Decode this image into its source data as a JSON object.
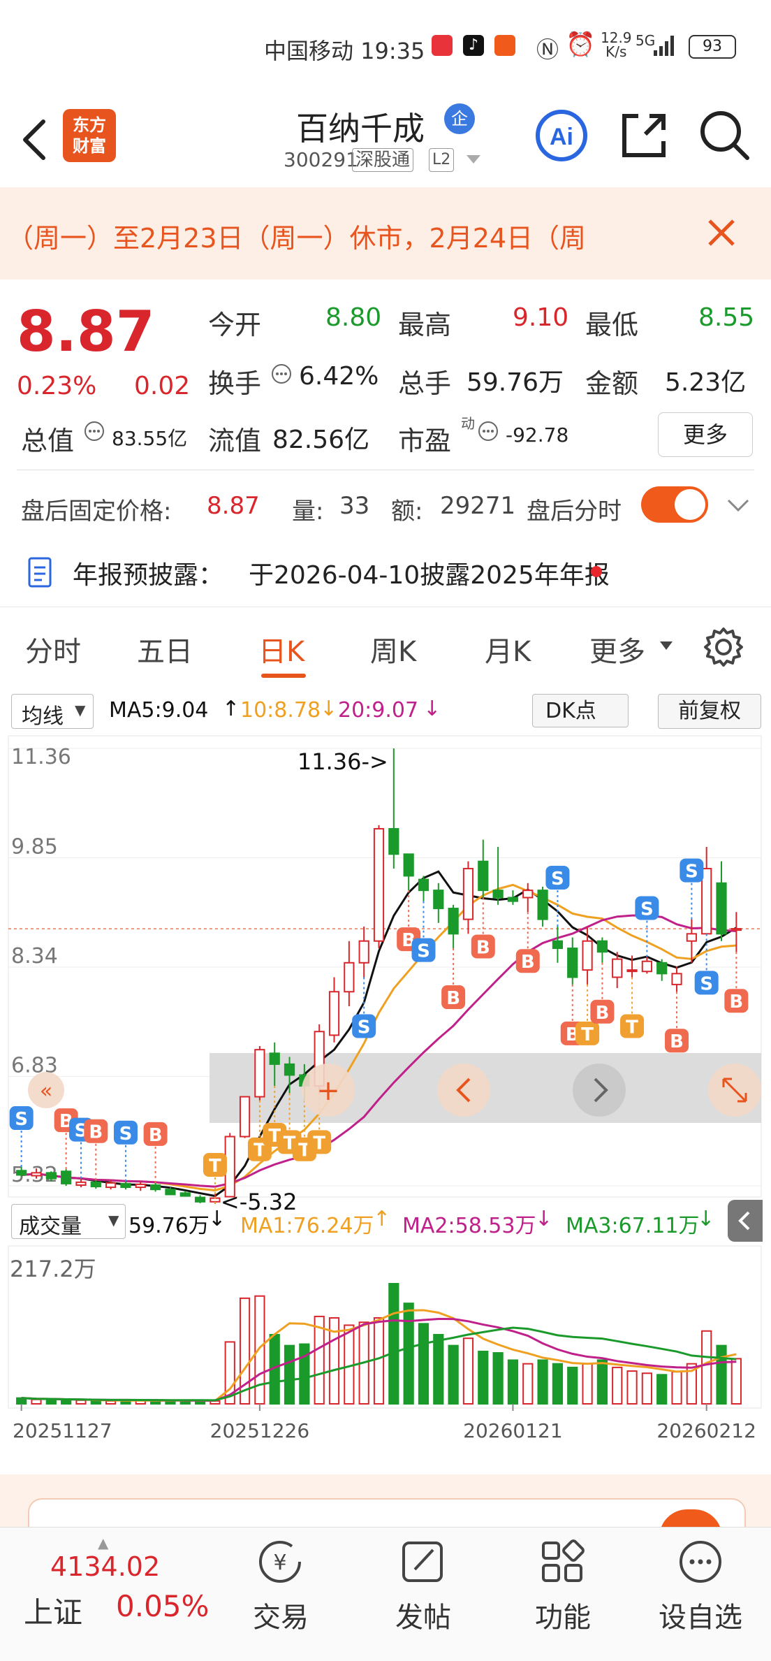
{
  "status": {
    "carrier_time": "中国移动 19:35",
    "net_speed_top": "12.9",
    "net_speed_bottom": "K/s",
    "net": "5G",
    "battery": "93"
  },
  "header": {
    "logo_line1": "东方",
    "logo_line2": "财富",
    "title": "百纳千成",
    "qi_badge": "企",
    "code": "300291",
    "tag1": "深股通",
    "tag2": "L2"
  },
  "notice": {
    "text": "（周一）至2月23日（周一）休市，2月24日（周"
  },
  "quote": {
    "price": "8.87",
    "pct": "0.23%",
    "change": "0.02",
    "open_label": "今开",
    "open": "8.80",
    "high_label": "最高",
    "high": "9.10",
    "low_label": "最低",
    "low": "8.55",
    "turnover_label": "换手",
    "turnover": "6.42%",
    "volume_label": "总手",
    "volume": "59.76万",
    "amount_label": "金额",
    "amount": "5.23亿",
    "mcap_label": "总值",
    "mcap": "83.55亿",
    "float_label": "流值",
    "float": "82.56亿",
    "pe_label": "市盈",
    "pe_sup": "动",
    "pe": "-92.78",
    "more_btn": "更多"
  },
  "afterhours": {
    "label": "盘后固定价格:",
    "price": "8.87",
    "vol_label": "量:",
    "vol": "33",
    "amt_label": "额:",
    "amt": "29271",
    "intraday_label": "盘后分时"
  },
  "annual": {
    "label": "年报预披露：",
    "text": "于2026-04-10披露2025年年报"
  },
  "tabs": [
    "分时",
    "五日",
    "日K",
    "周K",
    "月K",
    "更多"
  ],
  "chart_toolbar": {
    "ma_select": "均线",
    "ma5": "MA5:9.04",
    "ma10": "10:8.78",
    "ma20": "20:9.07",
    "dk_btn": "DK点",
    "fq_btn": "前复权",
    "vol_select": "成交量",
    "vol_val": "59.76万",
    "vma1": "MA1:76.24万",
    "vma2": "MA2:58.53万",
    "vma3": "MA3:67.11万"
  },
  "colors": {
    "up": "#d9262c",
    "down": "#1a9a2a",
    "accent": "#f05a1a",
    "ma5": "#111111",
    "ma10": "#f0a020",
    "ma20": "#c0208a"
  },
  "chart_data": {
    "type": "candlestick",
    "y_ticks": [
      "11.36",
      "9.85",
      "8.34",
      "6.83",
      "5.32"
    ],
    "ylim": [
      5.32,
      11.36
    ],
    "high_annotation": "11.36->",
    "low_annotation": "<-5.32",
    "vol_max_label": "217.2万",
    "x_labels": [
      "20251127",
      "20251226",
      "20260121",
      "20260212"
    ],
    "candles": [
      [
        5.53,
        5.47,
        5.58,
        5.45
      ],
      [
        5.46,
        5.5,
        5.56,
        5.42
      ],
      [
        5.5,
        5.42,
        5.52,
        5.38
      ],
      [
        5.52,
        5.35,
        5.55,
        5.32
      ],
      [
        5.33,
        5.37,
        5.42,
        5.3
      ],
      [
        5.37,
        5.31,
        5.4,
        5.28
      ],
      [
        5.3,
        5.36,
        5.4,
        5.27
      ],
      [
        5.35,
        5.3,
        5.38,
        5.27
      ],
      [
        5.3,
        5.34,
        5.38,
        5.25
      ],
      [
        5.33,
        5.27,
        5.36,
        5.24
      ],
      [
        5.27,
        5.2,
        5.3,
        5.2
      ],
      [
        5.22,
        5.18,
        5.25,
        5.17
      ],
      [
        5.16,
        5.1,
        5.19,
        5.08
      ],
      [
        5.1,
        5.15,
        5.22,
        5.07
      ],
      [
        5.17,
        6.0,
        6.05,
        5.17
      ],
      [
        6.0,
        6.55,
        6.55,
        5.98
      ],
      [
        6.55,
        7.2,
        7.25,
        6.5
      ],
      [
        7.15,
        7.0,
        7.3,
        6.7
      ],
      [
        7.0,
        6.85,
        7.1,
        6.6
      ],
      [
        6.85,
        6.7,
        7.0,
        6.5
      ],
      [
        6.7,
        7.45,
        7.55,
        6.6
      ],
      [
        7.4,
        8.0,
        8.2,
        7.3
      ],
      [
        8.0,
        8.4,
        8.7,
        7.8
      ],
      [
        8.4,
        8.7,
        8.9,
        8.2
      ],
      [
        8.7,
        10.25,
        10.3,
        8.6
      ],
      [
        10.25,
        9.9,
        11.36,
        9.7
      ],
      [
        9.9,
        9.6,
        9.9,
        9.4
      ],
      [
        9.55,
        9.4,
        9.6,
        9.25
      ],
      [
        9.4,
        9.15,
        9.5,
        8.95
      ],
      [
        9.15,
        8.8,
        9.2,
        8.6
      ],
      [
        9.0,
        9.7,
        9.8,
        8.8
      ],
      [
        9.8,
        9.4,
        10.1,
        9.3
      ],
      [
        9.4,
        9.3,
        10.0,
        9.2
      ],
      [
        9.3,
        9.25,
        9.4,
        9.2
      ],
      [
        9.3,
        9.4,
        9.5,
        9.1
      ],
      [
        9.4,
        9.0,
        9.45,
        8.9
      ],
      [
        8.7,
        8.6,
        8.9,
        8.4
      ],
      [
        8.6,
        8.2,
        8.75,
        8.1
      ],
      [
        8.3,
        8.7,
        8.9,
        8.1
      ],
      [
        8.7,
        8.55,
        8.75,
        8.4
      ],
      [
        8.2,
        8.45,
        8.55,
        8.05
      ],
      [
        8.3,
        8.3,
        8.5,
        8.2
      ],
      [
        8.28,
        8.42,
        8.48,
        8.25
      ],
      [
        8.4,
        8.25,
        8.45,
        8.15
      ],
      [
        8.1,
        8.25,
        8.35,
        8.0
      ],
      [
        8.7,
        8.8,
        9.0,
        8.4
      ],
      [
        8.8,
        9.7,
        10.0,
        8.8
      ],
      [
        9.5,
        8.8,
        9.8,
        8.7
      ],
      [
        8.85,
        8.87,
        9.1,
        8.55
      ]
    ],
    "volumes": [
      8,
      6,
      6,
      5,
      5,
      4,
      4,
      5,
      5,
      4,
      4,
      5,
      4,
      4,
      85,
      145,
      148,
      95,
      80,
      82,
      120,
      118,
      108,
      112,
      118,
      165,
      138,
      110,
      95,
      80,
      90,
      72,
      70,
      60,
      55,
      60,
      55,
      50,
      55,
      60,
      50,
      45,
      42,
      40,
      44,
      55,
      100,
      80,
      62
    ]
  },
  "overlay": {
    "plus": "+"
  },
  "bottom_nav": {
    "index_val": "4134.02",
    "index_name": "上证",
    "index_pct": "0.05%",
    "trade": "交易",
    "post": "发帖",
    "func": "功能",
    "watch": "设自选"
  }
}
